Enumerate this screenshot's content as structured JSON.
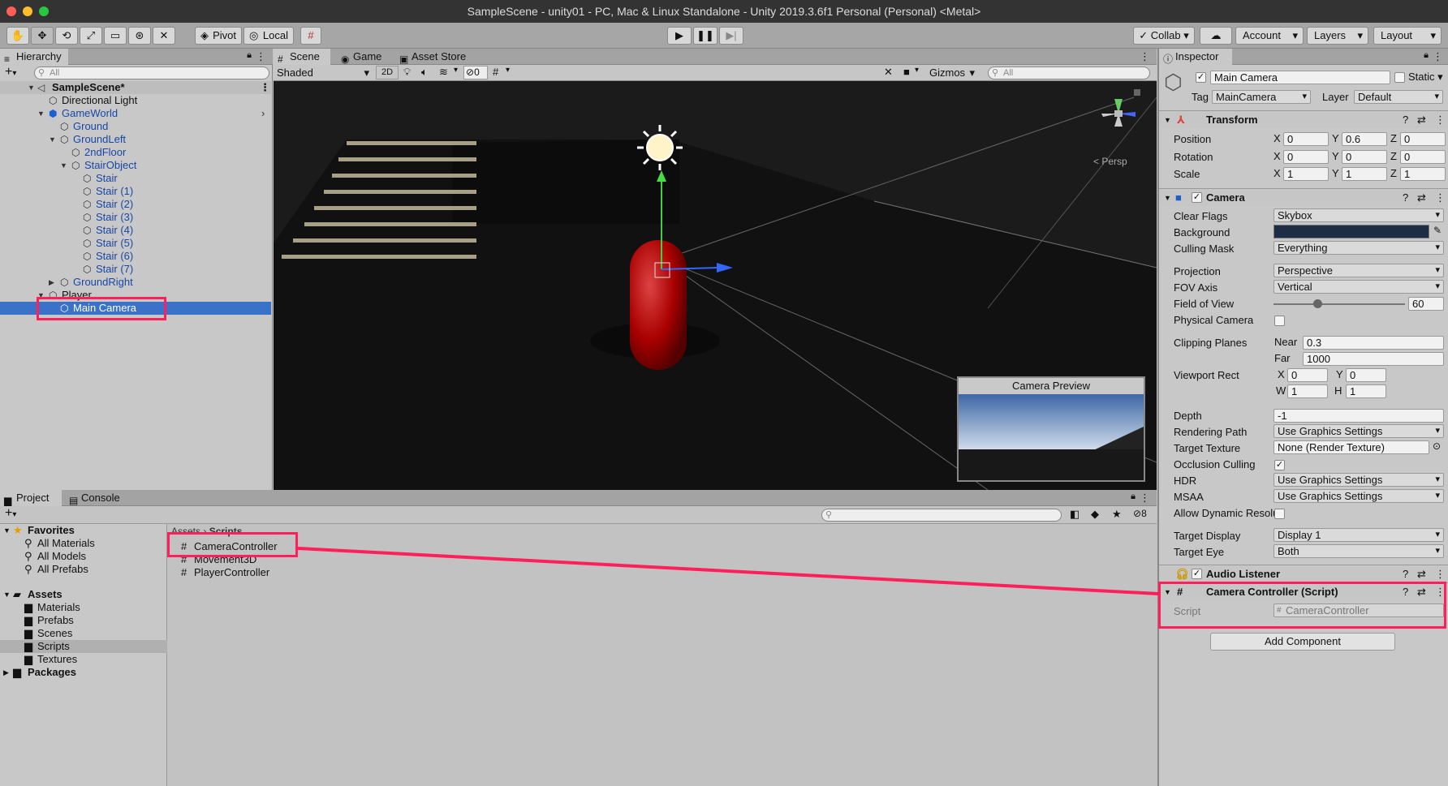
{
  "window": {
    "title": "SampleScene - unity01 - PC, Mac & Linux Standalone - Unity 2019.3.6f1 Personal (Personal) <Metal>"
  },
  "toolbar": {
    "pivot": "Pivot",
    "local": "Local",
    "collab": "Collab",
    "account": "Account",
    "layers": "Layers",
    "layout": "Layout"
  },
  "hierarchy": {
    "tab": "Hierarchy",
    "search_placeholder": "All",
    "scene": "SampleScene*",
    "items": [
      "Directional Light",
      "GameWorld",
      "Ground",
      "GroundLeft",
      "2ndFloor",
      "StairObject",
      "Stair",
      "Stair (1)",
      "Stair (2)",
      "Stair (3)",
      "Stair (4)",
      "Stair (5)",
      "Stair (6)",
      "Stair (7)",
      "GroundRight",
      "Player",
      "Main Camera"
    ]
  },
  "scene_view": {
    "tabs": [
      "Scene",
      "Game",
      "Asset Store"
    ],
    "shading": "Shaded",
    "mode2d": "2D",
    "hidden_count": "0",
    "gizmos": "Gizmos",
    "search_placeholder": "All",
    "persp": "< Persp",
    "camera_preview": "Camera Preview"
  },
  "project": {
    "tabs": [
      "Project",
      "Console"
    ],
    "badge": "8",
    "favorites": "Favorites",
    "favorite_items": [
      "All Materials",
      "All Models",
      "All Prefabs"
    ],
    "assets": "Assets",
    "asset_folders": [
      "Materials",
      "Prefabs",
      "Scenes",
      "Scripts",
      "Textures"
    ],
    "packages": "Packages",
    "breadcrumb": [
      "Assets",
      "Scripts"
    ],
    "files": [
      "CameraController",
      "Movement3D",
      "PlayerController"
    ]
  },
  "inspector": {
    "tab": "Inspector",
    "object_name": "Main Camera",
    "static_label": "Static",
    "tag_label": "Tag",
    "tag_value": "MainCamera",
    "layer_label": "Layer",
    "layer_value": "Default",
    "transform": {
      "title": "Transform",
      "position": "Position",
      "rotation": "Rotation",
      "scale": "Scale",
      "pos": [
        "0",
        "0.6",
        "0"
      ],
      "rot": [
        "0",
        "0",
        "0"
      ],
      "scl": [
        "1",
        "1",
        "1"
      ],
      "axes": [
        "X",
        "Y",
        "Z"
      ]
    },
    "camera": {
      "title": "Camera",
      "clear_flags": "Clear Flags",
      "clear_flags_v": "Skybox",
      "background": "Background",
      "culling_mask": "Culling Mask",
      "culling_mask_v": "Everything",
      "projection": "Projection",
      "projection_v": "Perspective",
      "fov_axis": "FOV Axis",
      "fov_axis_v": "Vertical",
      "fov": "Field of View",
      "fov_v": "60",
      "physical": "Physical Camera",
      "clipping": "Clipping Planes",
      "near": "Near",
      "near_v": "0.3",
      "far": "Far",
      "far_v": "1000",
      "viewport": "Viewport Rect",
      "vx": "0",
      "vy": "0",
      "vw": "1",
      "vh": "1",
      "depth": "Depth",
      "depth_v": "-1",
      "rpath": "Rendering Path",
      "rpath_v": "Use Graphics Settings",
      "target_tex": "Target Texture",
      "target_tex_v": "None (Render Texture)",
      "occlusion": "Occlusion Culling",
      "hdr": "HDR",
      "hdr_v": "Use Graphics Settings",
      "msaa": "MSAA",
      "msaa_v": "Use Graphics Settings",
      "dyn_res": "Allow Dynamic Resolu",
      "target_display": "Target Display",
      "target_display_v": "Display 1",
      "target_eye": "Target Eye",
      "target_eye_v": "Both",
      "bg_color": "#1d2d45"
    },
    "audio": "Audio Listener",
    "script_comp": "Camera Controller (Script)",
    "script_label": "Script",
    "script_value": "CameraController",
    "add_component": "Add Component"
  },
  "colors": {
    "highlight": "#ff1f5a",
    "selection": "#3a72c8",
    "prefab": "#1747a6"
  }
}
